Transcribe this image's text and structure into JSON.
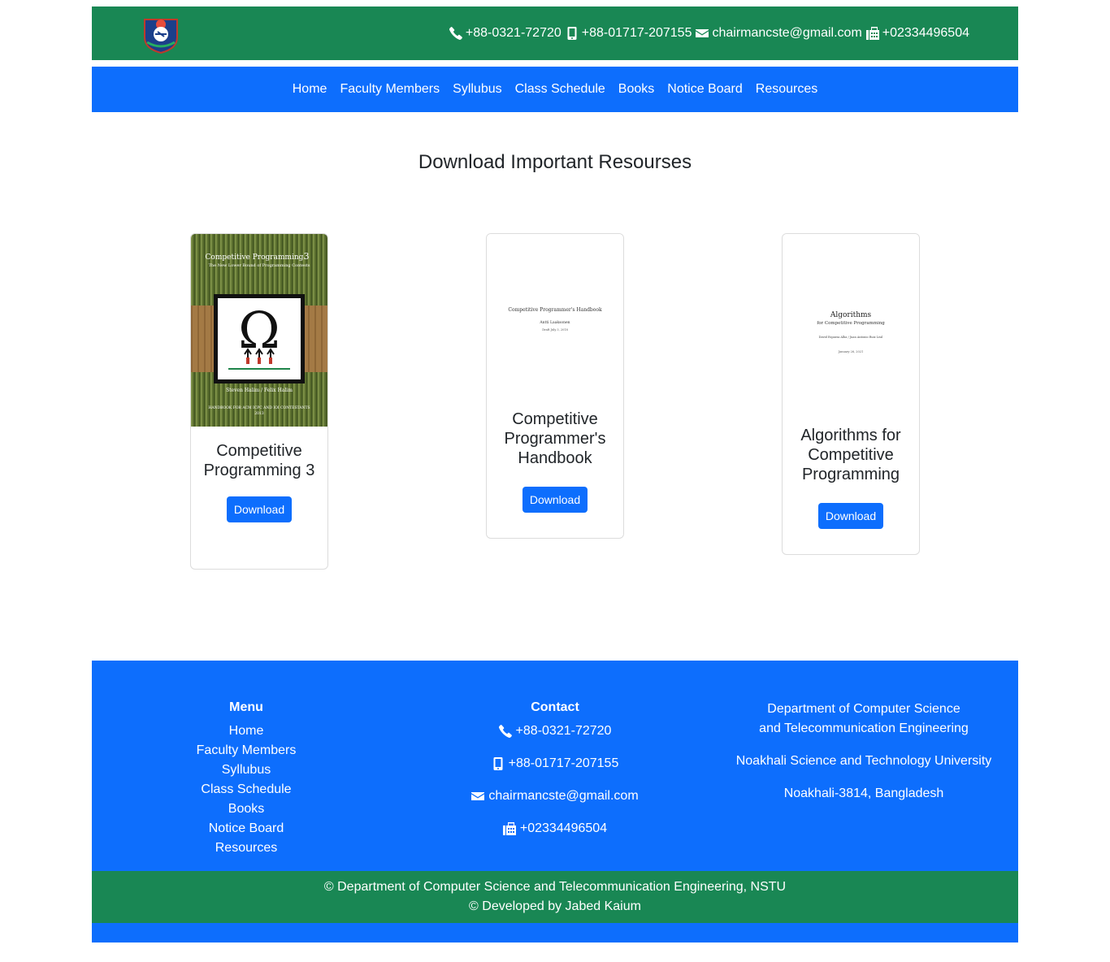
{
  "header": {
    "logo_alt": "University crest",
    "phone": "+88-0321-72720",
    "mobile": "+88-01717-207155",
    "email": "chairmancste@gmail.com",
    "fax": "+02334496504"
  },
  "nav": {
    "items": [
      "Home",
      "Faculty Members",
      "Syllubus",
      "Class Schedule",
      "Books",
      "Notice Board",
      "Resources"
    ]
  },
  "page": {
    "title": "Download Important Resourses"
  },
  "cards": [
    {
      "title": "Competitive Programming 3",
      "button": "Download",
      "cover": {
        "heading": "Competitive Programming",
        "edition": "3",
        "subtitle": "The New Lower Bound of Programming Contests",
        "authors": "Steven Halim / Felix Halim",
        "footer": "HANDBOOK FOR ACM ICPC AND IOI CONTESTANTS",
        "year": "2013"
      }
    },
    {
      "title": "Competitive Programmer's Handbook",
      "button": "Download",
      "cover": {
        "heading": "Competitive Programmer's Handbook",
        "author": "Antti Laaksonen",
        "date": "Draft July 3, 2018"
      }
    },
    {
      "title": "Algorithms for Competitive Programming",
      "button": "Download",
      "cover": {
        "heading": "Algorithms",
        "subtitle": "for Competitive Programming",
        "authors": "David Esparza Alba / Juan Antonio Ruiz Leal",
        "date": "January 26, 2021"
      }
    }
  ],
  "footer": {
    "menu_heading": "Menu",
    "menu_items": [
      "Home",
      "Faculty Members",
      "Syllubus",
      "Class Schedule",
      "Books",
      "Notice Board",
      "Resources"
    ],
    "contact_heading": "Contact",
    "phone": "+88-0321-72720",
    "mobile": "+88-01717-207155",
    "email": "chairmancste@gmail.com",
    "fax": "+02334496504",
    "dept_line1": "Department of Computer Science and Telecommunication Engineering",
    "university": "Noakhali Science and Technology University",
    "address": "Noakhali-3814, Bangladesh",
    "copyright1": "© Department of Computer Science and Telecommunication Engineering, NSTU",
    "copyright2": "© Developed by Jabed Kaium"
  },
  "colors": {
    "green": "#198754",
    "blue": "#0d6efd"
  }
}
